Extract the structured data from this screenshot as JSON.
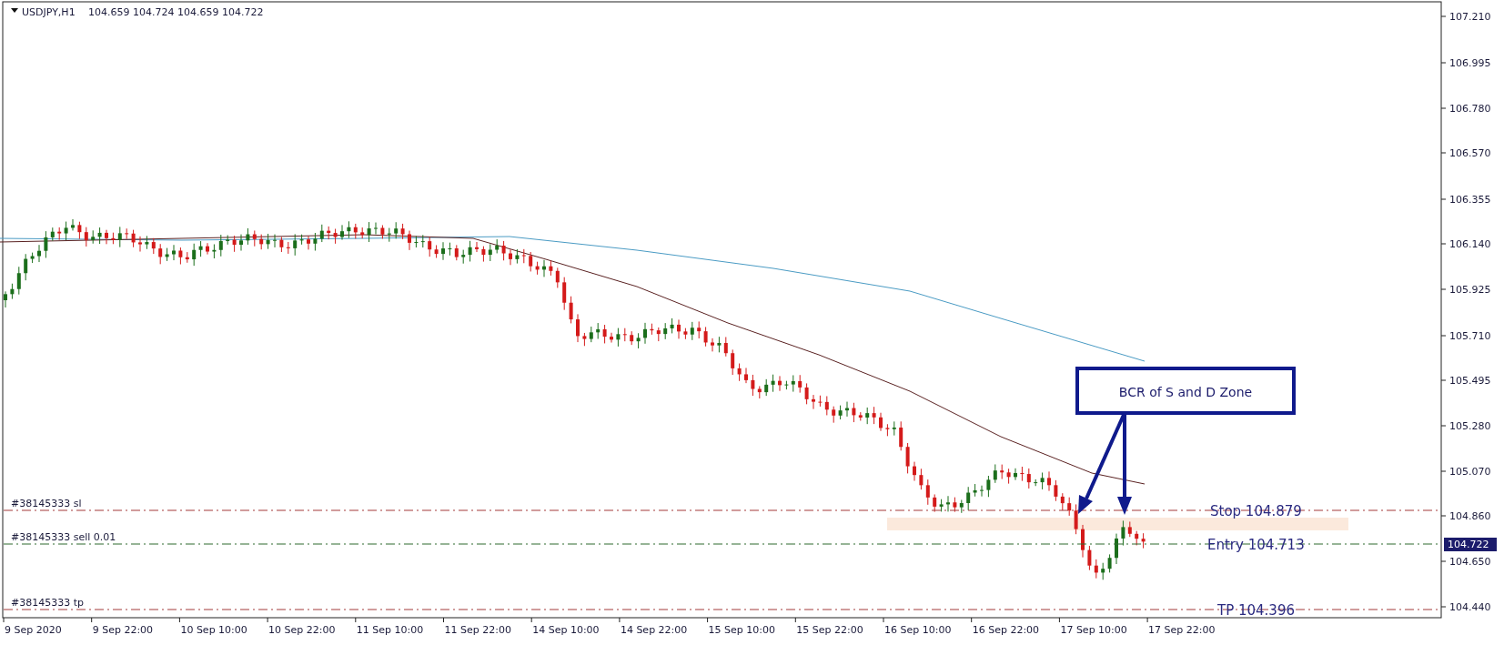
{
  "chart": {
    "symbol": "USDJPY,H1",
    "quote": "104.659 104.724 104.659 104.722"
  },
  "price_axis": [
    "107.210",
    "106.995",
    "106.780",
    "106.570",
    "106.355",
    "106.140",
    "105.925",
    "105.710",
    "105.495",
    "105.280",
    "105.070",
    "104.860",
    "104.650",
    "104.440"
  ],
  "current_price": "104.722",
  "time_axis": [
    "9 Sep 2020",
    "9 Sep 22:00",
    "10 Sep 10:00",
    "10 Sep 22:00",
    "11 Sep 10:00",
    "11 Sep 22:00",
    "14 Sep 10:00",
    "14 Sep 22:00",
    "15 Sep 10:00",
    "15 Sep 22:00",
    "16 Sep 10:00",
    "16 Sep 22:00",
    "17 Sep 10:00",
    "17 Sep 22:00"
  ],
  "order_lines": [
    {
      "kind": "sl",
      "label": "#38145333 sl",
      "tag": "Stop 104.879"
    },
    {
      "kind": "entry",
      "label": "#38145333 sell 0.01",
      "tag": "Entry 104.713"
    },
    {
      "kind": "tp",
      "label": "#38145333 tp",
      "tag": "TP 104.396"
    }
  ],
  "callout": {
    "text": "BCR of S and D Zone"
  }
}
